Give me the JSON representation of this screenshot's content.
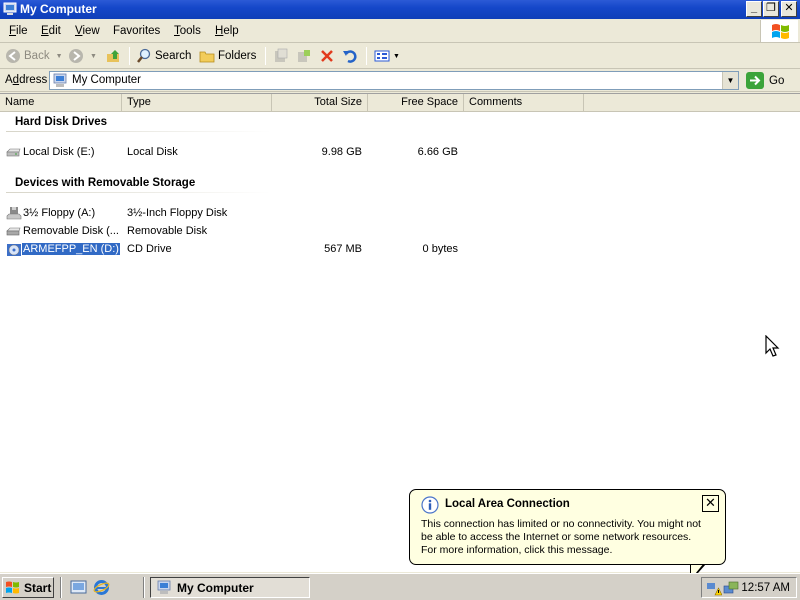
{
  "window": {
    "title": "My Computer",
    "controls": {
      "minimize": "_",
      "restore": "❐",
      "close": "✕"
    }
  },
  "menu": {
    "items": [
      {
        "key": "F",
        "rest": "ile"
      },
      {
        "key": "E",
        "rest": "dit"
      },
      {
        "key": "V",
        "rest": "iew"
      },
      {
        "key": "F",
        "rest": "avorites",
        "prefix": "",
        "underline_index": 0
      },
      {
        "key": "T",
        "rest": "ools"
      },
      {
        "key": "H",
        "rest": "elp"
      }
    ]
  },
  "toolbar": {
    "back_label": "Back",
    "search_label": "Search",
    "folders_label": "Folders"
  },
  "address": {
    "label_key": "d",
    "label_pre": "A",
    "label_post": "dress",
    "value": "My Computer",
    "go_label": "Go"
  },
  "columns": {
    "name": "Name",
    "type": "Type",
    "total_size": "Total Size",
    "free_space": "Free Space",
    "comments": "Comments"
  },
  "groups": [
    {
      "title": "Hard Disk Drives",
      "items": [
        {
          "name": "Local Disk (E:)",
          "type": "Local Disk",
          "total_size": "9.98 GB",
          "free_space": "6.66 GB",
          "icon": "hard-disk-icon"
        }
      ]
    },
    {
      "title": "Devices with Removable Storage",
      "items": [
        {
          "name": "3½ Floppy (A:)",
          "type": "3½-Inch Floppy Disk",
          "total_size": "",
          "free_space": "",
          "icon": "floppy-drive-icon"
        },
        {
          "name": "Removable Disk (...",
          "type": "Removable Disk",
          "total_size": "",
          "free_space": "",
          "icon": "removable-disk-icon"
        },
        {
          "name": "ARMEFPP_EN (D:)",
          "type": "CD Drive",
          "total_size": "567 MB",
          "free_space": "0 bytes",
          "icon": "cd-drive-icon",
          "selected": true
        }
      ]
    }
  ],
  "balloon": {
    "title": "Local Area Connection",
    "close": "✕",
    "lines": [
      "This connection has limited or no connectivity. You might not",
      "be able to access the Internet or some network resources.",
      "For more information, click this message."
    ]
  },
  "taskbar": {
    "start_label": "Start",
    "task_label": "My Computer",
    "clock": "12:57 AM"
  },
  "colors": {
    "titlebar": "#1547c9",
    "selection": "#316ac5",
    "balloon_bg": "#ffffe1"
  }
}
